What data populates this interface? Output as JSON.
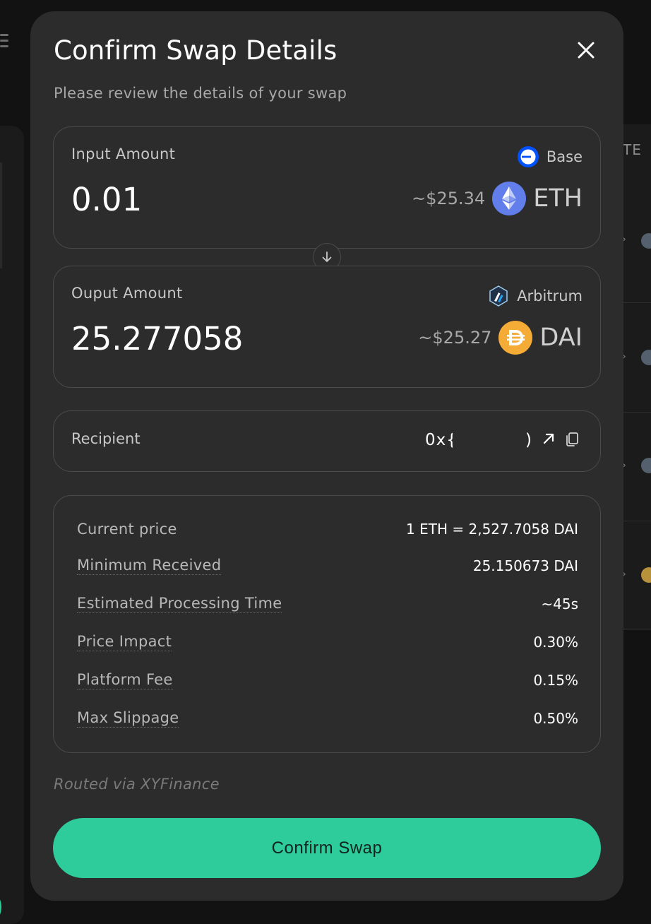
{
  "modal": {
    "title": "Confirm Swap Details",
    "subtitle": "Please review the details of your swap"
  },
  "input": {
    "label": "Input Amount",
    "amount": "0.01",
    "network": "Base",
    "network_icon": "base-network-icon",
    "usd": "~$25.34",
    "token": "ETH",
    "token_icon": "eth-icon"
  },
  "output": {
    "label": "Ouput Amount",
    "amount": "25.277058",
    "network": "Arbitrum",
    "network_icon": "arbitrum-network-icon",
    "usd": "~$25.27",
    "token": "DAI",
    "token_icon": "dai-icon"
  },
  "recipient": {
    "label": "Recipient",
    "address_start": "0x{",
    "address_end": ")"
  },
  "details": [
    {
      "label": "Current price",
      "value": "1 ETH = 2,527.7058 DAI"
    },
    {
      "label": "Minimum Received",
      "value": "25.150673 DAI"
    },
    {
      "label": "Estimated Processing Time",
      "value": "~45s"
    },
    {
      "label": "Price Impact",
      "value": "0.30%"
    },
    {
      "label": "Platform Fee",
      "value": "0.15%"
    },
    {
      "label": "Max Slippage",
      "value": "0.50%"
    }
  ],
  "routed_via": "Routed via XYFinance",
  "confirm_label": "Confirm Swap",
  "background": {
    "right_header_fragment": "TE"
  },
  "colors": {
    "accent": "#2ecc9a",
    "modal_bg": "#2c2c2c",
    "eth": "#627eea",
    "dai": "#f5ac37",
    "base": "#0052ff"
  }
}
